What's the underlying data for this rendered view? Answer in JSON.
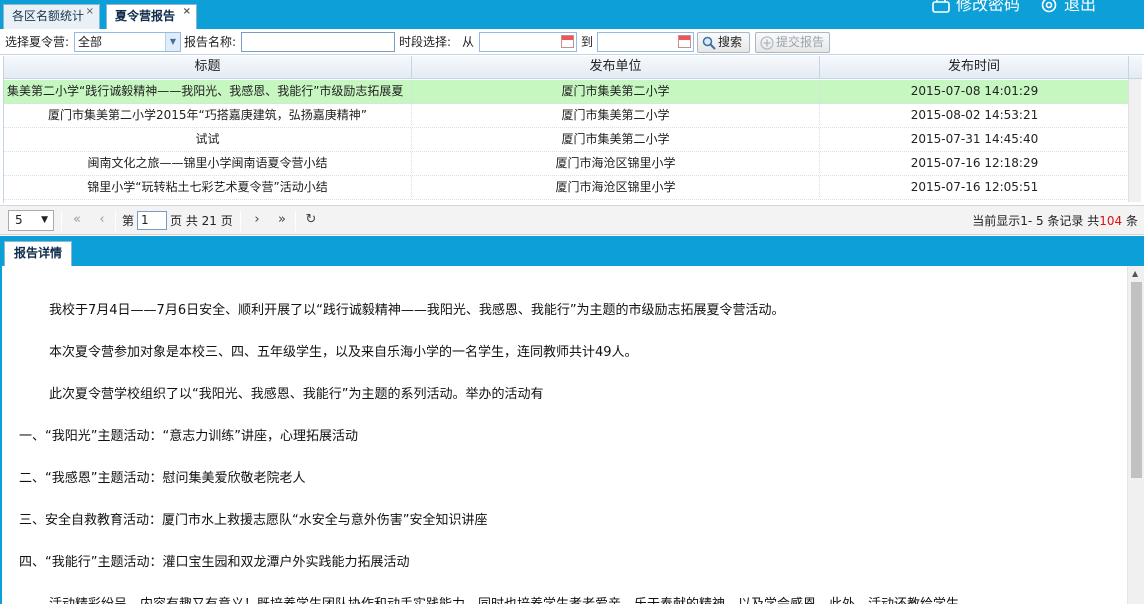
{
  "top_tabs": [
    {
      "label": "各区名额统计",
      "close": "×"
    },
    {
      "label": "夏令营报告",
      "close": "×"
    }
  ],
  "header_links": {
    "change_password": "修改密码",
    "logout": "退出"
  },
  "toolbar": {
    "camp_label": "选择夏令营:",
    "camp_value": "全部",
    "report_name_label": "报告名称:",
    "report_name_value": "",
    "time_label": "时段选择:",
    "from_label": "从",
    "from_value": "",
    "to_label": "到",
    "to_value": "",
    "search_label": "搜索",
    "submit_label": "提交报告"
  },
  "grid": {
    "columns": [
      "标题",
      "发布单位",
      "发布时间"
    ],
    "rows": [
      {
        "title": "集美第二小学“践行诚毅精神——我阳光、我感恩、我能行”市级励志拓展夏",
        "unit": "厦门市集美第二小学",
        "time": "2015-07-08 14:01:29",
        "selected": true
      },
      {
        "title": "厦门市集美第二小学2015年“巧搭嘉庚建筑，弘扬嘉庚精神”",
        "unit": "厦门市集美第二小学",
        "time": "2015-08-02 14:53:21",
        "selected": false
      },
      {
        "title": "试试",
        "unit": "厦门市集美第二小学",
        "time": "2015-07-31 14:45:40",
        "selected": false
      },
      {
        "title": "闽南文化之旅——锦里小学闽南语夏令营小结",
        "unit": "厦门市海沧区锦里小学",
        "time": "2015-07-16 12:18:29",
        "selected": false
      },
      {
        "title": "锦里小学“玩转粘土七彩艺术夏令营”活动小结",
        "unit": "厦门市海沧区锦里小学",
        "time": "2015-07-16 12:05:51",
        "selected": false
      }
    ]
  },
  "pager": {
    "page_size": "5",
    "page_prefix": "第",
    "page_value": "1",
    "page_suffix": "页 共 21 页",
    "info_prefix": "当前显示1- 5 条记录 共",
    "total": "104",
    "info_suffix": "条"
  },
  "detail": {
    "tab_label": "报告详情",
    "paragraphs": [
      "我校于7月4日——7月6日安全、顺利开展了以“践行诚毅精神——我阳光、我感恩、我能行”为主题的市级励志拓展夏令营活动。",
      "本次夏令营参加对象是本校三、四、五年级学生，以及来自乐海小学的一名学生，连同教师共计49人。",
      "此次夏令营学校组织了以“我阳光、我感恩、我能行”为主题的系列活动。举办的活动有",
      "一、“我阳光”主题活动：“意志力训练”讲座，心理拓展活动",
      "二、“我感恩”主题活动：慰问集美爱欣敬老院老人",
      "三、安全自救教育活动：厦门市水上救援志愿队“水安全与意外伤害”安全知识讲座",
      "四、“我能行”主题活动：灌口宝生园和双龙潭户外实践能力拓展活动",
      "活动精彩纷呈，内容有趣又有意义！既培养学生团队协作和动手实践能力，同时也培养学生孝老爱亲、乐于奉献的精神，以及学会感恩。此外，活动还教给学生"
    ]
  },
  "colors": {
    "accent": "#0c9fd8",
    "selected_row": "#c7f7c0",
    "total_count": "#e01010"
  }
}
